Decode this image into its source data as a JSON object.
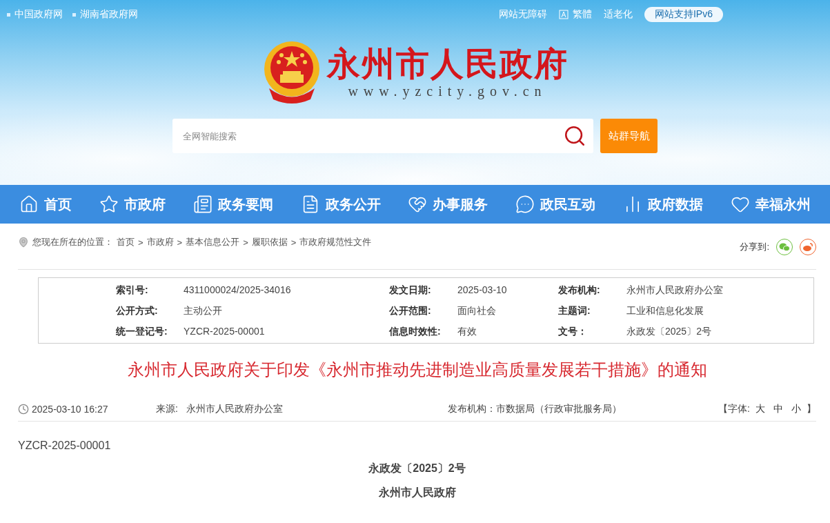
{
  "top_links": [
    "中国政府网",
    "湖南省政府网"
  ],
  "top_tools": [
    {
      "label": "网站无障碍",
      "kind": "text"
    },
    {
      "label": "繁體",
      "kind": "icon"
    },
    {
      "label": "适老化",
      "kind": "text"
    },
    {
      "label": "网站支持IPv6",
      "kind": "pill"
    }
  ],
  "site": {
    "title": "永州市人民政府",
    "url": "www.yzcity.gov.cn"
  },
  "search": {
    "placeholder": "全网智能搜索",
    "button": "站群导航"
  },
  "nav": [
    {
      "label": "首页",
      "kind": "home"
    },
    {
      "label": "市政府",
      "kind": "star"
    },
    {
      "label": "政务要闻",
      "kind": "news"
    },
    {
      "label": "政务公开",
      "kind": "doc"
    },
    {
      "label": "办事服务",
      "kind": "hands"
    },
    {
      "label": "政民互动",
      "kind": "chat"
    },
    {
      "label": "政府数据",
      "kind": "chart"
    },
    {
      "label": "幸福永州",
      "kind": "heart"
    }
  ],
  "breadcrumb": {
    "prefix": "您现在所在的位置：",
    "separator": ">",
    "items": [
      "首页",
      "市政府",
      "基本信息公开",
      "履职依据",
      "市政府规范性文件"
    ]
  },
  "share": {
    "label": "分享到:",
    "targets": [
      {
        "kind": "wechat",
        "color": "#6cbf3e"
      },
      {
        "kind": "weibo",
        "color": "#f0642d"
      }
    ]
  },
  "info": [
    [
      {
        "label": "索引号:",
        "value": "4311000024/2025-34016"
      },
      {
        "label": "发文日期:",
        "value": "2025-03-10"
      },
      {
        "label": "发布机构:",
        "value": "永州市人民政府办公室"
      }
    ],
    [
      {
        "label": "公开方式:",
        "value": "主动公开"
      },
      {
        "label": "公开范围:",
        "value": "面向社会"
      },
      {
        "label": "主题词:",
        "value": "工业和信息化发展"
      }
    ],
    [
      {
        "label": "统一登记号:",
        "value": "YZCR-2025-00001"
      },
      {
        "label": "信息时效性:",
        "value": "有效"
      },
      {
        "label": "文号：",
        "value": "永政发〔2025〕2号"
      }
    ]
  ],
  "article": {
    "title": "永州市人民政府关于印发《永州市推动先进制造业高质量发展若干措施》的通知",
    "time": "2025-03-10 16:27",
    "source_label": "来源:",
    "source": "永州市人民政府办公室",
    "publisher": "发布机构：市数据局（行政审批服务局）",
    "font_size": {
      "open": "【字体:",
      "sizes": [
        "大",
        "中",
        "小"
      ],
      "close": "】"
    },
    "body": [
      {
        "kind": "plain",
        "text": "YZCR-2025-00001"
      },
      {
        "kind": "center",
        "text": "永政发〔2025〕2号"
      },
      {
        "kind": "center",
        "text": "永州市人民政府"
      }
    ]
  }
}
